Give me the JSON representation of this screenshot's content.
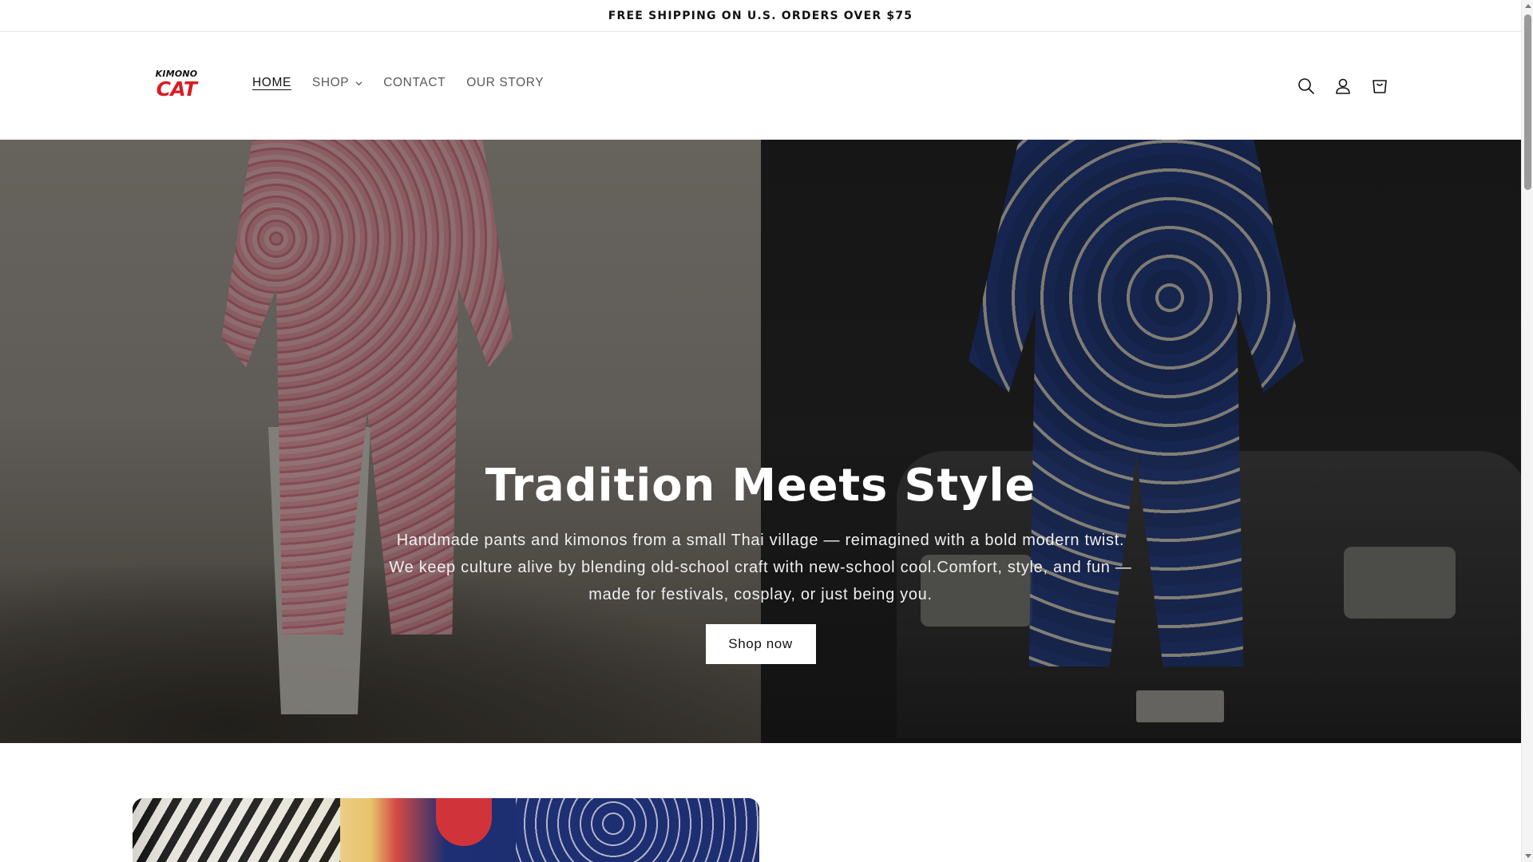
{
  "announcement": {
    "text": "FREE SHIPPING ON U.S. ORDERS OVER $75"
  },
  "header": {
    "logo": {
      "line1": "KIMONO",
      "line2": "CAT"
    },
    "nav": [
      {
        "label": "HOME",
        "active": true
      },
      {
        "label": "SHOP",
        "has_dropdown": true
      },
      {
        "label": "CONTACT"
      },
      {
        "label": "OUR STORY"
      }
    ],
    "icons": [
      "search-icon",
      "account-icon",
      "cart-icon"
    ]
  },
  "hero": {
    "title": "Tradition Meets Style",
    "text": "Handmade pants and kimonos from a small Thai village — reimagined with a bold modern twist. We keep culture alive by blending old-school craft with new-school cool.Comfort, style, and fun — made for festivals, cosplay, or just being you.",
    "button_label": "Shop now"
  },
  "colors": {
    "logo_red": "#d71d24",
    "text": "#121212",
    "nav_muted": "#5a5a5a"
  }
}
